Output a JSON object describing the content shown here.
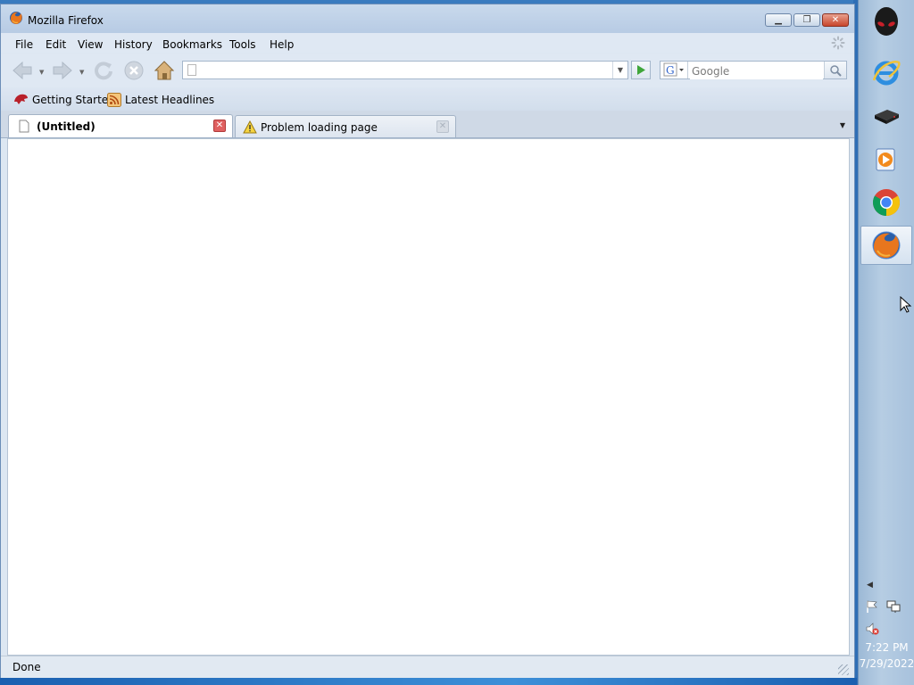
{
  "window": {
    "title": "Mozilla Firefox",
    "controls": {
      "minimize": "minimize",
      "maximize": "maximize",
      "close": "close"
    }
  },
  "menu": {
    "items": [
      "File",
      "Edit",
      "View",
      "History",
      "Bookmarks",
      "Tools",
      "Help"
    ]
  },
  "navigation": {
    "url_value": "",
    "search_engine": "Google",
    "search_placeholder": "Google"
  },
  "bookmarks": {
    "items": [
      "Getting Started",
      "Latest Headlines"
    ]
  },
  "tabs": [
    {
      "label": "(Untitled)",
      "active": true,
      "icon": "blank-page-icon"
    },
    {
      "label": "Problem loading page",
      "active": false,
      "icon": "warning-icon"
    }
  ],
  "status": {
    "text": "Done"
  },
  "taskbar": {
    "apps": [
      "alienware-icon",
      "internet-explorer-icon",
      "drive-icon",
      "media-player-icon",
      "chrome-icon",
      "firefox-icon"
    ],
    "active_app": "firefox-icon",
    "time": "7:22 PM",
    "date": "7/29/2022"
  },
  "colors": {
    "titlebar": "#c4d6eb",
    "close_button": "#c8452c",
    "taskbar": "#b0c8e0",
    "desktop": "#2f6eb5"
  }
}
